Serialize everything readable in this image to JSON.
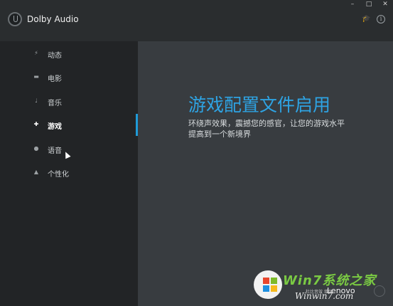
{
  "window": {
    "title": "Dolby Audio",
    "controls": {
      "minimize": "–",
      "maximize": "□",
      "close": "✕"
    },
    "header_icons": [
      "graduation-cap-icon",
      "info-icon"
    ]
  },
  "sidebar": {
    "items": [
      {
        "label": "动态",
        "icon": "bolt-icon",
        "active": false
      },
      {
        "label": "电影",
        "icon": "film-icon",
        "active": false
      },
      {
        "label": "音乐",
        "icon": "music-note-icon",
        "active": false
      },
      {
        "label": "游戏",
        "icon": "gamepad-icon",
        "active": true
      },
      {
        "label": "语音",
        "icon": "people-icon",
        "active": false
      },
      {
        "label": "个性化",
        "icon": "person-icon",
        "active": false
      }
    ]
  },
  "main": {
    "headline": "游戏配置文件启用",
    "description": "环绕声效果，震撼您的感官，让您的游戏水平提高到一个新境界"
  },
  "overlay": {
    "brand": "Lenovo",
    "watermark_title": "Win7系统之家",
    "watermark_url": "Winwin7.com",
    "small_text": "杜比音效 增强"
  },
  "colors": {
    "accent": "#1f9bd8",
    "sidebar_bg": "#222426",
    "main_bg": "#383c40"
  }
}
